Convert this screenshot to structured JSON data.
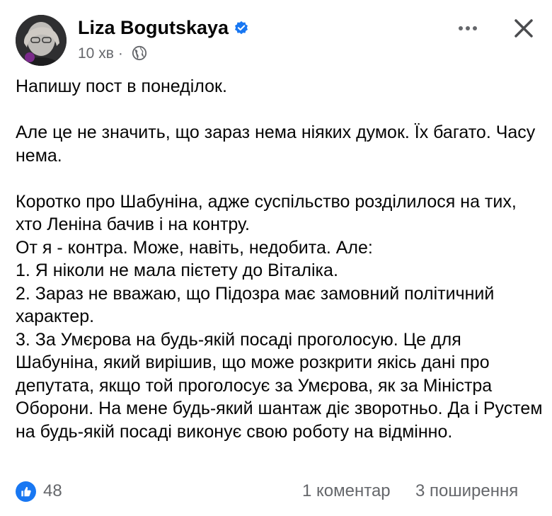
{
  "post": {
    "author_name": "Liza Bogutskaya",
    "timestamp": "10 хв",
    "separator": "·",
    "audience_icon": "globe-icon",
    "verified_icon": "verified-badge-icon",
    "body": [
      "Напишу пост в понеділок.",
      "",
      "Але це не значить, що зараз нема ніяких думок. Їх багато. Часу нема.",
      "",
      "Коротко про Шабуніна, адже суспільство розділилося на тих, хто Леніна бачив і на контру.",
      "От я - контра. Може, навіть, недобита. Але:",
      "1. Я ніколи не мала пієтету до Віталіка.",
      "2. Зараз не вважаю, що Підозра має замовний політичний характер.",
      "3. За Умєрова на будь-якій посаді проголосую. Це для Шабуніна, який вирішив, що може розкрити якісь дані про депутата, якщо той проголосує за Умєрова, як за Міністра Оборони. На мене будь-який шантаж діє зворотньо. Да і Рустем на будь-якій посаді виконує свою роботу на відмінно."
    ]
  },
  "footer": {
    "reaction_icon": "like-icon",
    "reaction_count": "48",
    "comments_label": "1 коментар",
    "shares_label": "3 поширення"
  },
  "colors": {
    "text": "#050505",
    "secondary": "#65676b",
    "brand_blue": "#1877f2"
  }
}
